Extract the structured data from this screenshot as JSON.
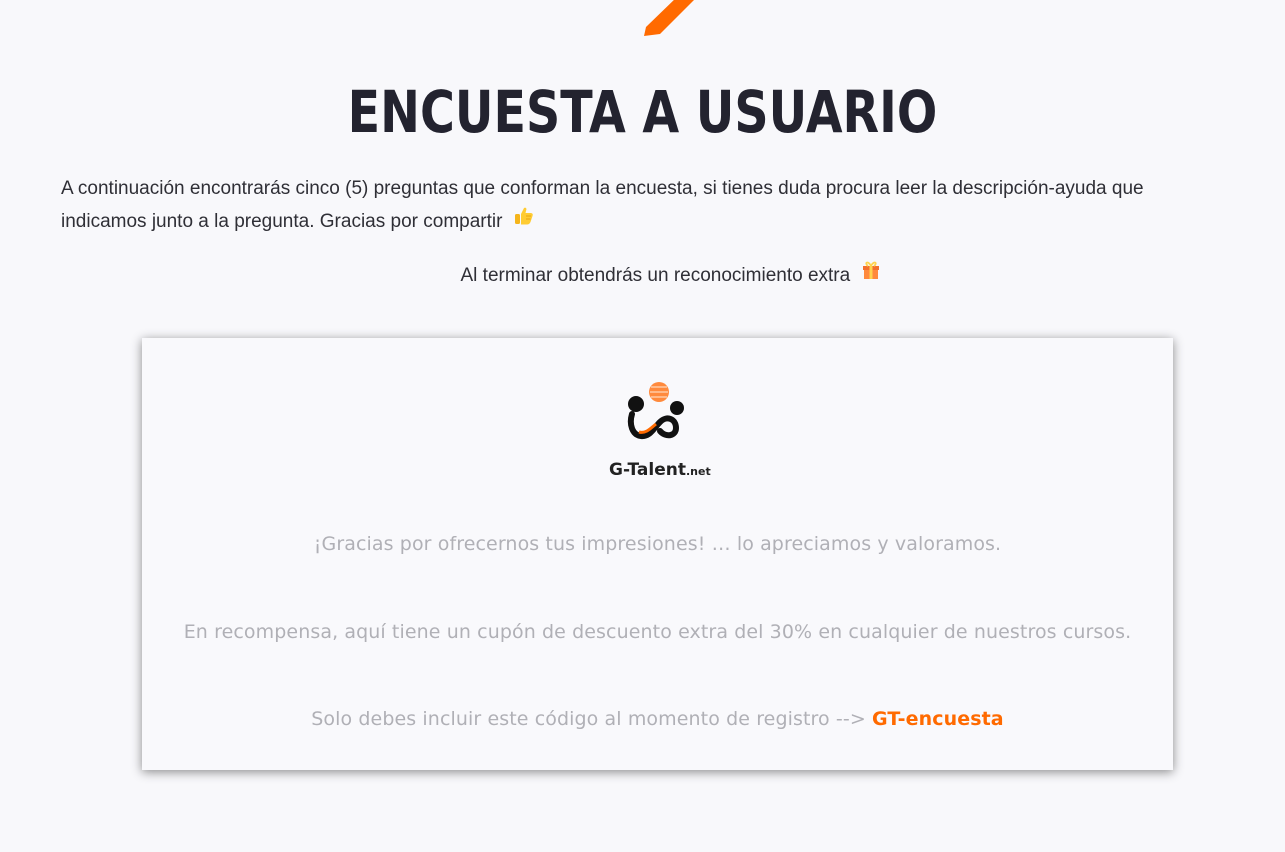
{
  "page": {
    "title": "ENCUESTA A USUARIO",
    "intro": "A continuación encontrarás cinco (5) preguntas que conforman la encuesta, si tienes duda procura leer la descripción-ayuda que indicamos junto a la pregunta. Gracias por compartir",
    "reward_note": "Al terminar obtendrás un reconocimiento extra"
  },
  "card": {
    "logo_text": "G-Talent",
    "logo_suffix": ".net",
    "thanks": "¡Gracias por ofrecernos tus impresiones! … lo apreciamos y valoramos.",
    "reward": "En recompensa, aquí tiene un cupón de descuento extra del 30% en cualquier de nuestros cursos.",
    "code_prompt": "Solo debes incluir este código al momento de registro -->",
    "coupon_code": "GT-encuesta"
  },
  "icons": {
    "thumbs_up": "thumbs-up-icon",
    "gift": "gift-icon",
    "logo": "g-talent-logo-icon"
  },
  "colors": {
    "accent": "#ff6a00",
    "title": "#23232f",
    "body_text": "#2f2f36",
    "muted_text": "#b0b0b6",
    "background": "#f8f8fb"
  }
}
